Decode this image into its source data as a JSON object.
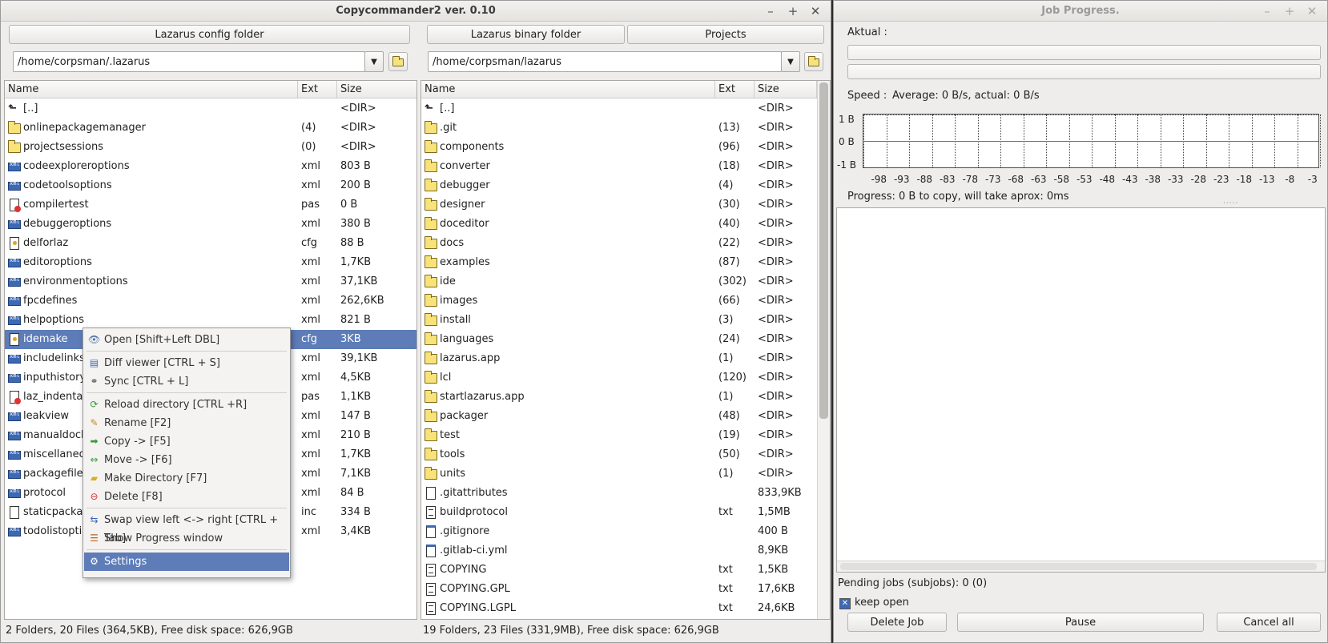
{
  "main": {
    "title": "Copycommander2 ver. 0.10",
    "window_buttons": [
      "–",
      "+",
      "✕"
    ],
    "left": {
      "folder_button": "Lazarus config folder",
      "path": "/home/corpsman/.lazarus",
      "columns": [
        "Name",
        "Ext",
        "Size"
      ],
      "rows": [
        {
          "name": "[..]",
          "ext": "",
          "size": "<DIR>",
          "icon": "up"
        },
        {
          "name": "onlinepackagemanager",
          "ext": "(4)",
          "size": "<DIR>",
          "icon": "folder"
        },
        {
          "name": "projectsessions",
          "ext": "(0)",
          "size": "<DIR>",
          "icon": "folder"
        },
        {
          "name": "codeexploreroptions",
          "ext": "xml",
          "size": "803 B",
          "icon": "xml"
        },
        {
          "name": "codetoolsoptions",
          "ext": "xml",
          "size": "200 B",
          "icon": "xml"
        },
        {
          "name": "compilertest",
          "ext": "pas",
          "size": "0 B",
          "icon": "pas"
        },
        {
          "name": "debuggeroptions",
          "ext": "xml",
          "size": "380 B",
          "icon": "xml"
        },
        {
          "name": "delforlaz",
          "ext": "cfg",
          "size": "88 B",
          "icon": "cfgic"
        },
        {
          "name": "editoroptions",
          "ext": "xml",
          "size": "1,7KB",
          "icon": "xml"
        },
        {
          "name": "environmentoptions",
          "ext": "xml",
          "size": "37,1KB",
          "icon": "xml"
        },
        {
          "name": "fpcdefines",
          "ext": "xml",
          "size": "262,6KB",
          "icon": "xml"
        },
        {
          "name": "helpoptions",
          "ext": "xml",
          "size": "821 B",
          "icon": "xml"
        },
        {
          "name": "idemake",
          "ext": "cfg",
          "size": "3KB",
          "icon": "cfgic",
          "selected": true
        },
        {
          "name": "includelinks",
          "ext": "xml",
          "size": "39,1KB",
          "icon": "xml"
        },
        {
          "name": "inputhistory",
          "ext": "xml",
          "size": "4,5KB",
          "icon": "xml"
        },
        {
          "name": "laz_indentation",
          "ext": "pas",
          "size": "1,1KB",
          "icon": "pas"
        },
        {
          "name": "leakview",
          "ext": "xml",
          "size": "147 B",
          "icon": "xml"
        },
        {
          "name": "manualdockconfig",
          "ext": "xml",
          "size": "210 B",
          "icon": "xml"
        },
        {
          "name": "miscellaneousoptions",
          "ext": "xml",
          "size": "1,7KB",
          "icon": "xml"
        },
        {
          "name": "packagefiles",
          "ext": "xml",
          "size": "7,1KB",
          "icon": "xml"
        },
        {
          "name": "protocol",
          "ext": "xml",
          "size": "84 B",
          "icon": "xml"
        },
        {
          "name": "staticpackages",
          "ext": "inc",
          "size": "334 B",
          "icon": "blank"
        },
        {
          "name": "todolistoptions",
          "ext": "xml",
          "size": "3,4KB",
          "icon": "xml"
        }
      ],
      "status": "2 Folders, 20 Files (364,5KB), Free disk space: 626,9GB"
    },
    "right": {
      "folder_button": "Lazarus binary folder",
      "projects_button": "Projects",
      "path": "/home/corpsman/lazarus",
      "columns": [
        "Name",
        "Ext",
        "Size"
      ],
      "rows": [
        {
          "name": "[..]",
          "ext": "",
          "size": "<DIR>",
          "icon": "up"
        },
        {
          "name": ".git",
          "ext": "(13)",
          "size": "<DIR>",
          "icon": "folder"
        },
        {
          "name": "components",
          "ext": "(96)",
          "size": "<DIR>",
          "icon": "folder"
        },
        {
          "name": "converter",
          "ext": "(18)",
          "size": "<DIR>",
          "icon": "folder"
        },
        {
          "name": "debugger",
          "ext": "(4)",
          "size": "<DIR>",
          "icon": "folder"
        },
        {
          "name": "designer",
          "ext": "(30)",
          "size": "<DIR>",
          "icon": "folder"
        },
        {
          "name": "doceditor",
          "ext": "(40)",
          "size": "<DIR>",
          "icon": "folder"
        },
        {
          "name": "docs",
          "ext": "(22)",
          "size": "<DIR>",
          "icon": "folder"
        },
        {
          "name": "examples",
          "ext": "(87)",
          "size": "<DIR>",
          "icon": "folder"
        },
        {
          "name": "ide",
          "ext": "(302)",
          "size": "<DIR>",
          "icon": "folder"
        },
        {
          "name": "images",
          "ext": "(66)",
          "size": "<DIR>",
          "icon": "folder"
        },
        {
          "name": "install",
          "ext": "(3)",
          "size": "<DIR>",
          "icon": "folder"
        },
        {
          "name": "languages",
          "ext": "(24)",
          "size": "<DIR>",
          "icon": "folder"
        },
        {
          "name": "lazarus.app",
          "ext": "(1)",
          "size": "<DIR>",
          "icon": "folder"
        },
        {
          "name": "lcl",
          "ext": "(120)",
          "size": "<DIR>",
          "icon": "folder"
        },
        {
          "name": "startlazarus.app",
          "ext": "(1)",
          "size": "<DIR>",
          "icon": "folder"
        },
        {
          "name": "packager",
          "ext": "(48)",
          "size": "<DIR>",
          "icon": "folder"
        },
        {
          "name": "test",
          "ext": "(19)",
          "size": "<DIR>",
          "icon": "folder"
        },
        {
          "name": "tools",
          "ext": "(50)",
          "size": "<DIR>",
          "icon": "folder"
        },
        {
          "name": "units",
          "ext": "(1)",
          "size": "<DIR>",
          "icon": "folder"
        },
        {
          "name": ".gitattributes",
          "ext": "",
          "size": "833,9KB",
          "icon": "blank"
        },
        {
          "name": "buildprotocol",
          "ext": "txt",
          "size": "1,5MB",
          "icon": "doc"
        },
        {
          "name": ".gitignore",
          "ext": "",
          "size": "400 B",
          "icon": "gi"
        },
        {
          "name": ".gitlab-ci.yml",
          "ext": "",
          "size": "8,9KB",
          "icon": "gi"
        },
        {
          "name": "COPYING",
          "ext": "txt",
          "size": "1,5KB",
          "icon": "doc"
        },
        {
          "name": "COPYING.GPL",
          "ext": "txt",
          "size": "17,6KB",
          "icon": "doc"
        },
        {
          "name": "COPYING.LGPL",
          "ext": "txt",
          "size": "24,6KB",
          "icon": "doc"
        }
      ],
      "status": "19 Folders, 23 Files (331,9MB), Free disk space: 626,9GB"
    },
    "context_menu": [
      {
        "label": "Open [Shift+Left DBL]",
        "icon": "eye-icon",
        "glyph": "👁",
        "color": "#4a6fa5"
      },
      {
        "sep": true
      },
      {
        "label": "Diff viewer [CTRL + S]",
        "icon": "diff-icon",
        "glyph": "▤",
        "color": "#3b69b3"
      },
      {
        "label": "Sync [CTRL + L]",
        "icon": "link-icon",
        "glyph": "⚭",
        "color": "#555"
      },
      {
        "sep": true
      },
      {
        "label": "Reload directory [CTRL +R]",
        "icon": "reload-icon",
        "glyph": "⟳",
        "color": "#3a9a3a"
      },
      {
        "label": "Rename [F2]",
        "icon": "pencil-icon",
        "glyph": "✎",
        "color": "#c08a20"
      },
      {
        "label": "Copy -> [F5]",
        "icon": "arrow-right-icon",
        "glyph": "➡",
        "color": "#3a9a3a"
      },
      {
        "label": "Move -> [F6]",
        "icon": "arrow-both-icon",
        "glyph": "⇔",
        "color": "#3a9a3a"
      },
      {
        "label": "Make Directory [F7]",
        "icon": "new-folder-icon",
        "glyph": "▰",
        "color": "#d9b020"
      },
      {
        "label": "Delete [F8]",
        "icon": "delete-icon",
        "glyph": "⊖",
        "color": "#d33"
      },
      {
        "sep": true
      },
      {
        "label": "Swap view left <-> right [CTRL + Tab]",
        "icon": "swap-icon",
        "glyph": "⇆",
        "color": "#3b69b3"
      },
      {
        "label": "Show Progress window",
        "icon": "progress-icon",
        "glyph": "☰",
        "color": "#c06020"
      },
      {
        "sep": true
      },
      {
        "label": "Settings",
        "icon": "gear-icon",
        "glyph": "⚙",
        "color": "#fff",
        "selected": true
      }
    ]
  },
  "progress": {
    "title": "Job Progress.",
    "window_buttons": [
      "–",
      "+",
      "✕"
    ],
    "aktual_label": "Aktual :",
    "speed_label": "Speed :",
    "speed_value": "Average: 0 B/s, actual: 0 B/s",
    "graph": {
      "y_labels": [
        "1 B",
        "0 B",
        "-1 B"
      ],
      "x_ticks": [
        "-98",
        "-93",
        "-88",
        "-83",
        "-78",
        "-73",
        "-68",
        "-63",
        "-58",
        "-53",
        "-48",
        "-43",
        "-38",
        "-33",
        "-28",
        "-23",
        "-18",
        "-13",
        "-8",
        "-3"
      ],
      "line_color": "#2e9b2e"
    },
    "progress_text": "Progress: 0 B to copy, will take aprox: 0ms",
    "pending_text": "Pending jobs (subjobs): 0 (0)",
    "keep_open_label": "keep open",
    "keep_open_checked": true,
    "buttons": {
      "delete": "Delete Job",
      "pause": "Pause",
      "cancel": "Cancel all"
    }
  }
}
